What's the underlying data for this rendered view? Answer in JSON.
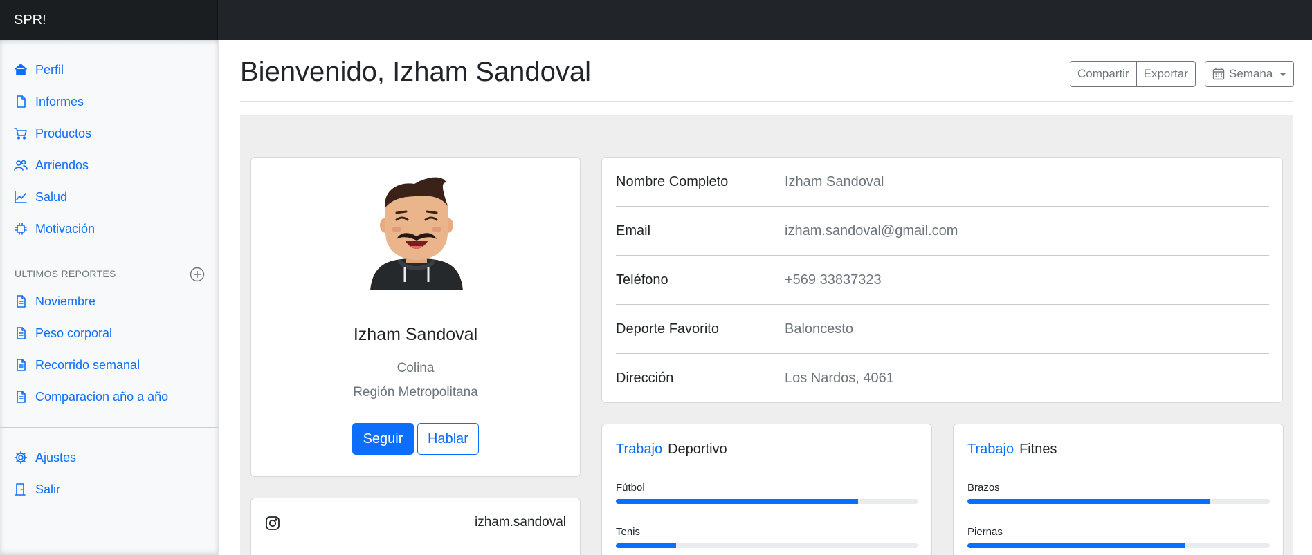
{
  "app": {
    "brand": "SPR!"
  },
  "sidebar": {
    "items": [
      {
        "label": "Perfil",
        "icon": "home-icon"
      },
      {
        "label": "Informes",
        "icon": "file-icon"
      },
      {
        "label": "Productos",
        "icon": "shopping-cart-icon"
      },
      {
        "label": "Arriendos",
        "icon": "users-icon"
      },
      {
        "label": "Salud",
        "icon": "chart-line-icon"
      },
      {
        "label": "Motivación",
        "icon": "puzzle-icon"
      }
    ],
    "reports_heading": "ULTIMOS REPORTES",
    "reports": [
      {
        "label": "Noviembre",
        "icon": "file-text-icon"
      },
      {
        "label": "Peso corporal",
        "icon": "file-text-icon"
      },
      {
        "label": "Recorrido semanal",
        "icon": "file-text-icon"
      },
      {
        "label": "Comparacion año a año",
        "icon": "file-text-icon"
      }
    ],
    "footer_items": [
      {
        "label": "Ajustes",
        "icon": "gear-icon"
      },
      {
        "label": "Salir",
        "icon": "door-exit-icon"
      }
    ]
  },
  "header": {
    "title": "Bienvenido, Izham Sandoval",
    "share_label": "Compartir",
    "export_label": "Exportar",
    "period_label": "Semana"
  },
  "profile": {
    "name": "Izham Sandoval",
    "city": "Colina",
    "region": "Región Metropolitana",
    "follow_label": "Seguir",
    "talk_label": "Hablar"
  },
  "social": {
    "instagram_handle": "izham.sandoval"
  },
  "info": {
    "rows": [
      {
        "label": "Nombre Completo",
        "value": "Izham Sandoval"
      },
      {
        "label": "Email",
        "value": "izham.sandoval@gmail.com"
      },
      {
        "label": "Teléfono",
        "value": "+569 33837323"
      },
      {
        "label": "Deporte Favorito",
        "value": "Baloncesto"
      },
      {
        "label": "Dirección",
        "value": "Los Nardos, 4061"
      }
    ]
  },
  "sport_work": {
    "accent": "Trabajo",
    "title": "Deportivo",
    "items": [
      {
        "label": "Fútbol",
        "progress": 0.8
      },
      {
        "label": "Tenis",
        "progress": 0.2
      }
    ]
  },
  "fitness_work": {
    "accent": "Trabajo",
    "title": "Fitnes",
    "items": [
      {
        "label": "Brazos",
        "progress": 0.8
      },
      {
        "label": "Piernas",
        "progress": 0.72
      }
    ]
  },
  "colors": {
    "primary": "#0d6efd",
    "navbar": "#212529",
    "muted": "#6c757d",
    "content_bg": "#eeeeee"
  }
}
